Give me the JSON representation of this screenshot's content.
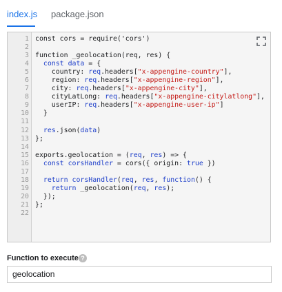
{
  "tabs": [
    {
      "label": "index.js",
      "active": true
    },
    {
      "label": "package.json",
      "active": false
    }
  ],
  "editor": {
    "lines": [
      [
        {
          "t": "const cors = require('cors')",
          "c": "fn"
        }
      ],
      [
        {
          "t": "",
          "c": "fn"
        }
      ],
      [
        {
          "t": "function _geolocation(req, res) {",
          "c": "fn"
        }
      ],
      [
        {
          "t": "  ",
          "c": "fn"
        },
        {
          "t": "const",
          "c": "kw"
        },
        {
          "t": " ",
          "c": "fn"
        },
        {
          "t": "data",
          "c": "var"
        },
        {
          "t": " = {",
          "c": "fn"
        }
      ],
      [
        {
          "t": "    country: ",
          "c": "fn"
        },
        {
          "t": "req",
          "c": "var"
        },
        {
          "t": ".headers[",
          "c": "fn"
        },
        {
          "t": "\"x-appengine-country\"",
          "c": "str"
        },
        {
          "t": "],",
          "c": "fn"
        }
      ],
      [
        {
          "t": "    region: ",
          "c": "fn"
        },
        {
          "t": "req",
          "c": "var"
        },
        {
          "t": ".headers[",
          "c": "fn"
        },
        {
          "t": "\"x-appengine-region\"",
          "c": "str"
        },
        {
          "t": "],",
          "c": "fn"
        }
      ],
      [
        {
          "t": "    city: ",
          "c": "fn"
        },
        {
          "t": "req",
          "c": "var"
        },
        {
          "t": ".headers[",
          "c": "fn"
        },
        {
          "t": "\"x-appengine-city\"",
          "c": "str"
        },
        {
          "t": "],",
          "c": "fn"
        }
      ],
      [
        {
          "t": "    cityLatLong: ",
          "c": "fn"
        },
        {
          "t": "req",
          "c": "var"
        },
        {
          "t": ".headers[",
          "c": "fn"
        },
        {
          "t": "\"x-appengine-citylatlong\"",
          "c": "str"
        },
        {
          "t": "],",
          "c": "fn"
        }
      ],
      [
        {
          "t": "    userIP: ",
          "c": "fn"
        },
        {
          "t": "req",
          "c": "var"
        },
        {
          "t": ".headers[",
          "c": "fn"
        },
        {
          "t": "\"x-appengine-user-ip\"",
          "c": "str"
        },
        {
          "t": "]",
          "c": "fn"
        }
      ],
      [
        {
          "t": "  }",
          "c": "fn"
        }
      ],
      [
        {
          "t": "",
          "c": "fn"
        }
      ],
      [
        {
          "t": "  ",
          "c": "fn"
        },
        {
          "t": "res",
          "c": "var"
        },
        {
          "t": ".json(",
          "c": "fn"
        },
        {
          "t": "data",
          "c": "var"
        },
        {
          "t": ")",
          "c": "fn"
        }
      ],
      [
        {
          "t": "};",
          "c": "fn"
        }
      ],
      [
        {
          "t": "",
          "c": "fn"
        }
      ],
      [
        {
          "t": "exports.geolocation = (",
          "c": "fn"
        },
        {
          "t": "req",
          "c": "var"
        },
        {
          "t": ", ",
          "c": "fn"
        },
        {
          "t": "res",
          "c": "var"
        },
        {
          "t": ") => {",
          "c": "fn"
        }
      ],
      [
        {
          "t": "  ",
          "c": "fn"
        },
        {
          "t": "const",
          "c": "kw"
        },
        {
          "t": " ",
          "c": "fn"
        },
        {
          "t": "corsHandler",
          "c": "var"
        },
        {
          "t": " = cors({ origin: ",
          "c": "fn"
        },
        {
          "t": "true",
          "c": "kw"
        },
        {
          "t": " })",
          "c": "fn"
        }
      ],
      [
        {
          "t": "",
          "c": "fn"
        }
      ],
      [
        {
          "t": "  ",
          "c": "fn"
        },
        {
          "t": "return",
          "c": "kw"
        },
        {
          "t": " ",
          "c": "fn"
        },
        {
          "t": "corsHandler",
          "c": "var"
        },
        {
          "t": "(",
          "c": "fn"
        },
        {
          "t": "req",
          "c": "var"
        },
        {
          "t": ", ",
          "c": "fn"
        },
        {
          "t": "res",
          "c": "var"
        },
        {
          "t": ", ",
          "c": "fn"
        },
        {
          "t": "function",
          "c": "kw"
        },
        {
          "t": "() {",
          "c": "fn"
        }
      ],
      [
        {
          "t": "    ",
          "c": "fn"
        },
        {
          "t": "return",
          "c": "kw"
        },
        {
          "t": " _geolocation(",
          "c": "fn"
        },
        {
          "t": "req",
          "c": "var"
        },
        {
          "t": ", ",
          "c": "fn"
        },
        {
          "t": "res",
          "c": "var"
        },
        {
          "t": ");",
          "c": "fn"
        }
      ],
      [
        {
          "t": "  });",
          "c": "fn"
        }
      ],
      [
        {
          "t": "};",
          "c": "fn"
        }
      ],
      [
        {
          "t": "",
          "c": "fn"
        }
      ]
    ],
    "expand_icon": "fullscreen-icon"
  },
  "function_field": {
    "label": "Function to execute",
    "help_icon": "help-icon",
    "value": "geolocation"
  },
  "colors": {
    "accent": "#1a73e8",
    "keyword": "#1e3fc9",
    "string": "#c41a16"
  }
}
